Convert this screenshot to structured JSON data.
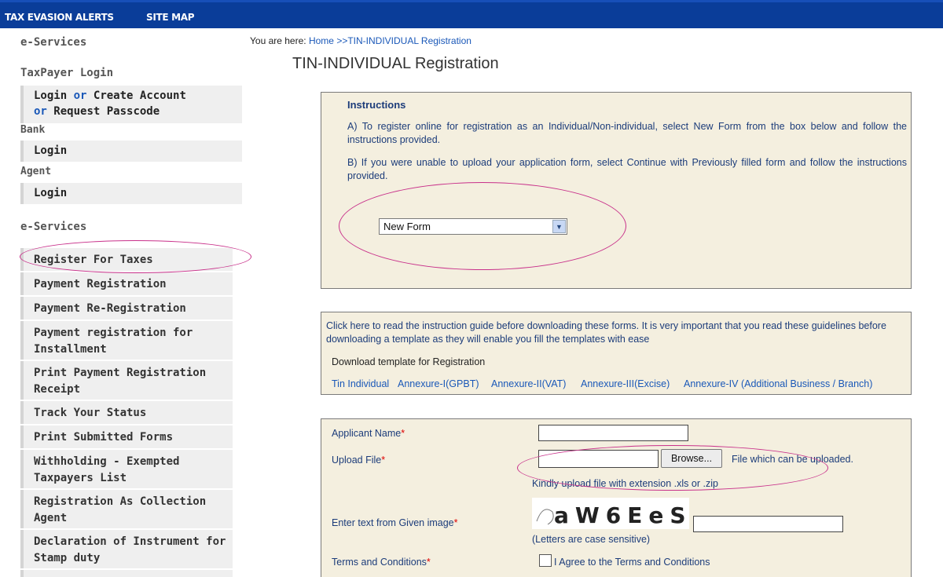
{
  "topnav": {
    "alerts": "TAX EVASION ALERTS",
    "sitemap": "SITE MAP"
  },
  "sidebar": {
    "heading1": "e-Services",
    "taxpayer_heading": "TaxPayer Login",
    "taxpayer_login": "Login",
    "taxpayer_or1": "or",
    "taxpayer_create": "Create Account",
    "taxpayer_or2": "or",
    "taxpayer_passcode": "Request Passcode",
    "bank_heading": "Bank",
    "bank_login": "Login",
    "agent_heading": "Agent",
    "agent_login": "Login",
    "heading2": "e-Services",
    "items": [
      {
        "line1": "Register For Taxes",
        "line2": ""
      },
      {
        "line1": "Payment Registration",
        "line2": ""
      },
      {
        "line1": "Payment Re-Registration",
        "line2": ""
      },
      {
        "line1": "Payment registration for",
        "line2": "Installment"
      },
      {
        "line1": "Print Payment Registration",
        "line2": "Receipt"
      },
      {
        "line1": "Track Your Status",
        "line2": ""
      },
      {
        "line1": "Print Submitted Forms",
        "line2": ""
      },
      {
        "line1": "Withholding - Exempted",
        "line2": "Taxpayers List"
      },
      {
        "line1": "Registration As Collection",
        "line2": "Agent"
      },
      {
        "line1": "Declaration of Instrument for",
        "line2": "Stamp duty"
      }
    ]
  },
  "breadcrumb": {
    "prefix": "You are here:",
    "home": "Home",
    "current": ">>TIN-INDIVIDUAL Registration"
  },
  "page_title": "TIN-INDIVIDUAL Registration",
  "instructions": {
    "title": "Instructions",
    "a": "A) To register online for registration as an Individual/Non-individual, select New Form from the box below and follow the instructions provided.",
    "b": "B) If you were unable to upload your application form, select Continue with Previously filled form and follow the instructions provided.",
    "select_value": "New Form"
  },
  "guide": {
    "text": "Click here to read the instruction guide before downloading these forms. It is very important that you read these guidelines before downloading a template as they will enable you fill the templates with ease",
    "download_title": "Download template for Registration",
    "templates": [
      "Tin Individual",
      "Annexure-I(GPBT)",
      "Annexure-II(VAT)",
      "Annexure-III(Excise)",
      "Annexure-IV (Additional Business / Branch)"
    ]
  },
  "form": {
    "applicant_label": "Applicant Name",
    "upload_label": "Upload File",
    "browse": "Browse...",
    "file_note": "File which can be uploaded.",
    "ext_note": "Kindly upload file with extension .xls or .zip",
    "captcha_label": "Enter text from Given image",
    "captcha_text": "aW6EeS",
    "case_note": "(Letters are case sensitive)",
    "terms_label": "Terms and Conditions",
    "agree": "I Agree to the Terms and Conditions",
    "asterisk": "*"
  },
  "colors": {
    "nav": "#0a3d99",
    "link": "#1a58b8",
    "panel": "#f4efdf",
    "annotation": "#c8308a"
  }
}
